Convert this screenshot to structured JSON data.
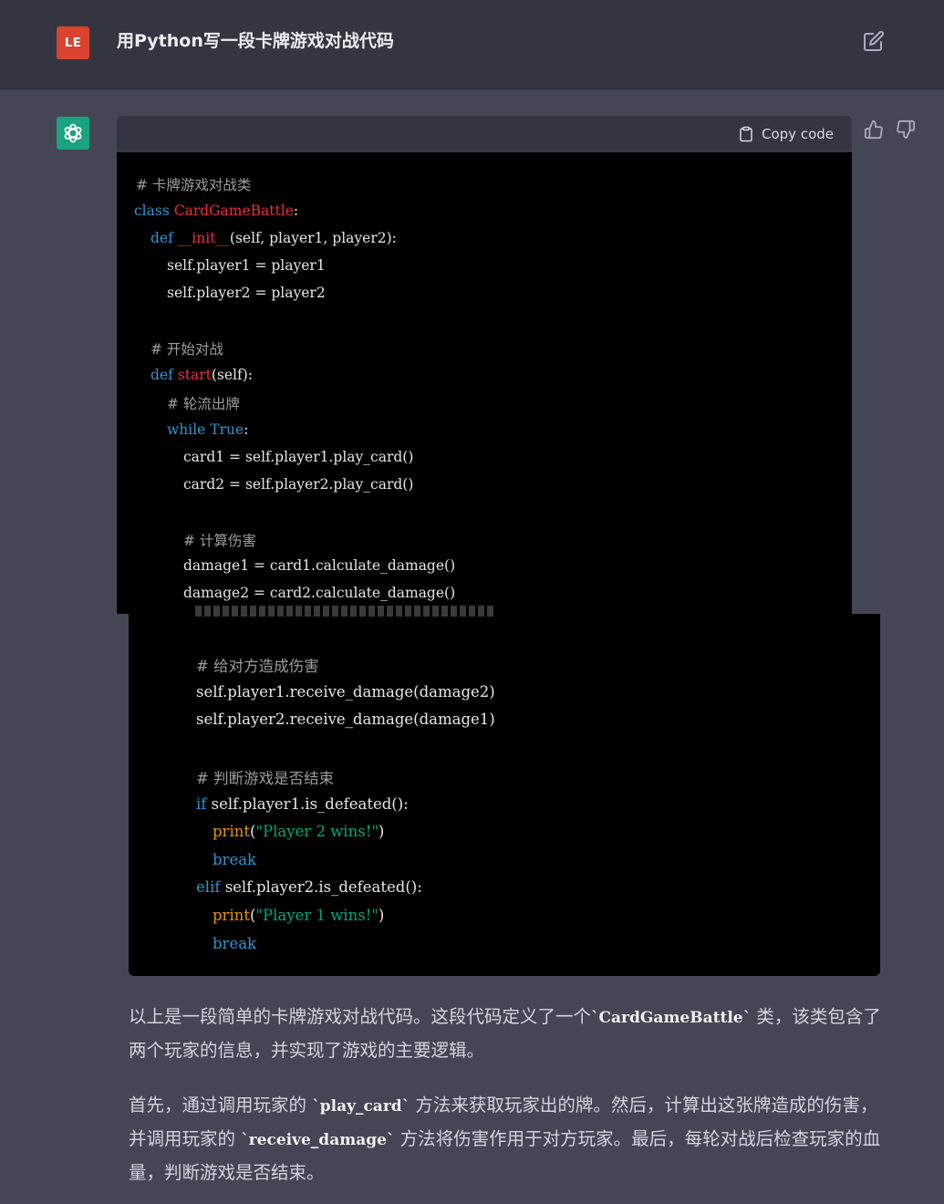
{
  "user": {
    "avatar_initials": "LE",
    "message": "用Python写一段卡牌游戏对战代码"
  },
  "code_block": {
    "copy_label": "Copy code",
    "part1": {
      "l1": "# 卡牌游戏对战类",
      "l2_kw": "class",
      "l2_name": "CardGameBattle",
      "l2_rest": ":",
      "l3_kw": "def",
      "l3_name": "__init__",
      "l3_rest": "(self, player1, player2):",
      "l4": "self.player1 = player1",
      "l5": "self.player2 = player2",
      "l6": "# 开始对战",
      "l7_kw": "def",
      "l7_name": "start",
      "l7_rest": "(self):",
      "l8": "# 轮流出牌",
      "l9_kw": "while",
      "l9_true": "True",
      "l9_rest": ":",
      "l10": "card1 = self.player1.play_card()",
      "l11": "card2 = self.player2.play_card()",
      "l12": "# 计算伤害",
      "l13": "damage1 = card1.calculate_damage()",
      "l14": "damage2 = card2.calculate_damage()"
    },
    "part2": {
      "l1": "# 给对方造成伤害",
      "l2": "self.player1.receive_damage(damage2)",
      "l3": "self.player2.receive_damage(damage1)",
      "l4": "# 判断游戏是否结束",
      "l5_kw": "if",
      "l5_rest": "self.player1.is_defeated():",
      "l6_fn": "print",
      "l6_open": "(",
      "l6_str": "\"Player 2 wins!\"",
      "l6_close": ")",
      "l7_kw": "break",
      "l8_kw": "elif",
      "l8_rest": "self.player2.is_defeated():",
      "l9_fn": "print",
      "l9_open": "(",
      "l9_str": "\"Player 1 wins!\"",
      "l9_close": ")",
      "l10_kw": "break"
    }
  },
  "response": {
    "p1_a": "以上是一段简单的卡牌游戏对战代码。这段代码定义了一个",
    "p1_code": "`CardGameBattle`",
    "p1_b": "类，该类包含了两个玩家的信息，并实现了游戏的主要逻辑。",
    "p2_a": "首先，通过调用玩家的",
    "p2_code1": "`play_card`",
    "p2_b": "方法来获取玩家出的牌。然后，计算出这张牌造成的伤害，并调用玩家的",
    "p2_code2": "`receive_damage`",
    "p2_c": "方法将伤害作用于对方玩家。最后，每轮对战后检查玩家的血量，判断游戏是否结束。"
  },
  "icons": {
    "edit": "edit-icon",
    "thumbs_up": "thumbs-up-icon",
    "thumbs_down": "thumbs-down-icon",
    "clipboard": "clipboard-icon",
    "openai": "openai-logo-icon"
  },
  "colors": {
    "page_bg": "#444654",
    "user_row_bg": "#343541",
    "user_avatar": "#d9432f",
    "gpt_avatar": "#19a37f",
    "code_bg": "#000000",
    "keyword": "#2e95d3",
    "class_name": "#f22c3d",
    "string": "#00a67d",
    "builtin": "#e9950c"
  }
}
